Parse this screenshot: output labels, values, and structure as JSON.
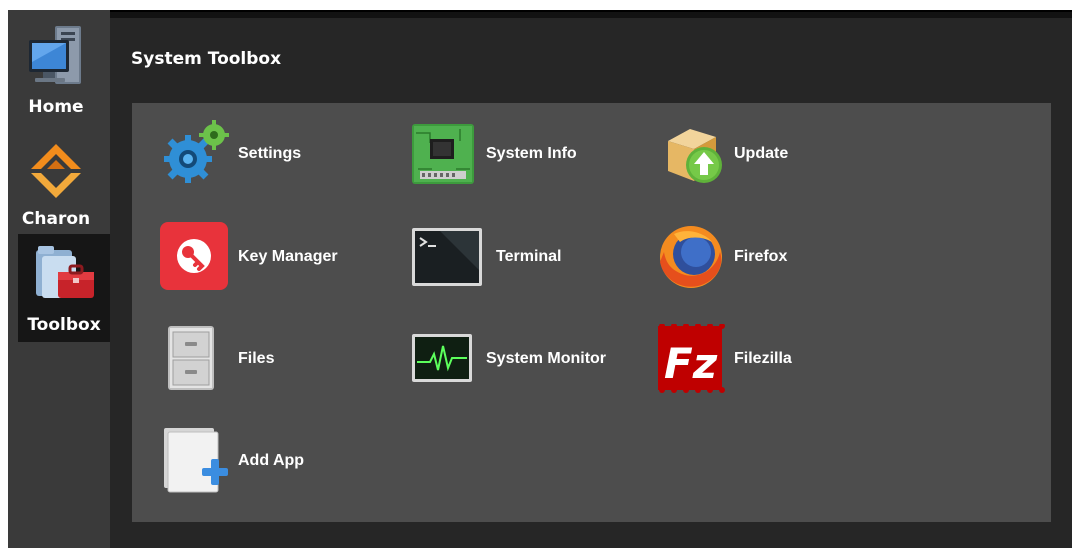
{
  "window": {
    "title": "System Toolbox"
  },
  "sidebar": {
    "items": [
      {
        "label": "Home",
        "icon": "computer-icon"
      },
      {
        "label": "Charon",
        "icon": "charon-logo-icon"
      },
      {
        "label": "Toolbox",
        "icon": "toolbox-icon",
        "active": true
      }
    ]
  },
  "apps": [
    {
      "label": "Settings",
      "icon": "gears-icon"
    },
    {
      "label": "System Info",
      "icon": "circuit-board-icon"
    },
    {
      "label": "Update",
      "icon": "package-update-icon"
    },
    {
      "label": "Key Manager",
      "icon": "key-icon"
    },
    {
      "label": "Terminal",
      "icon": "terminal-icon"
    },
    {
      "label": "Firefox",
      "icon": "firefox-icon"
    },
    {
      "label": "Files",
      "icon": "file-cabinet-icon"
    },
    {
      "label": "System Monitor",
      "icon": "pulse-monitor-icon"
    },
    {
      "label": "Filezilla",
      "icon": "filezilla-icon"
    },
    {
      "label": "Add App",
      "icon": "add-app-icon"
    }
  ],
  "colors": {
    "sidebar_bg": "#3a3a3a",
    "sidebar_active_bg": "#161616",
    "main_bg": "#262626",
    "panel_bg": "#4d4d4d",
    "text": "#ffffff"
  }
}
